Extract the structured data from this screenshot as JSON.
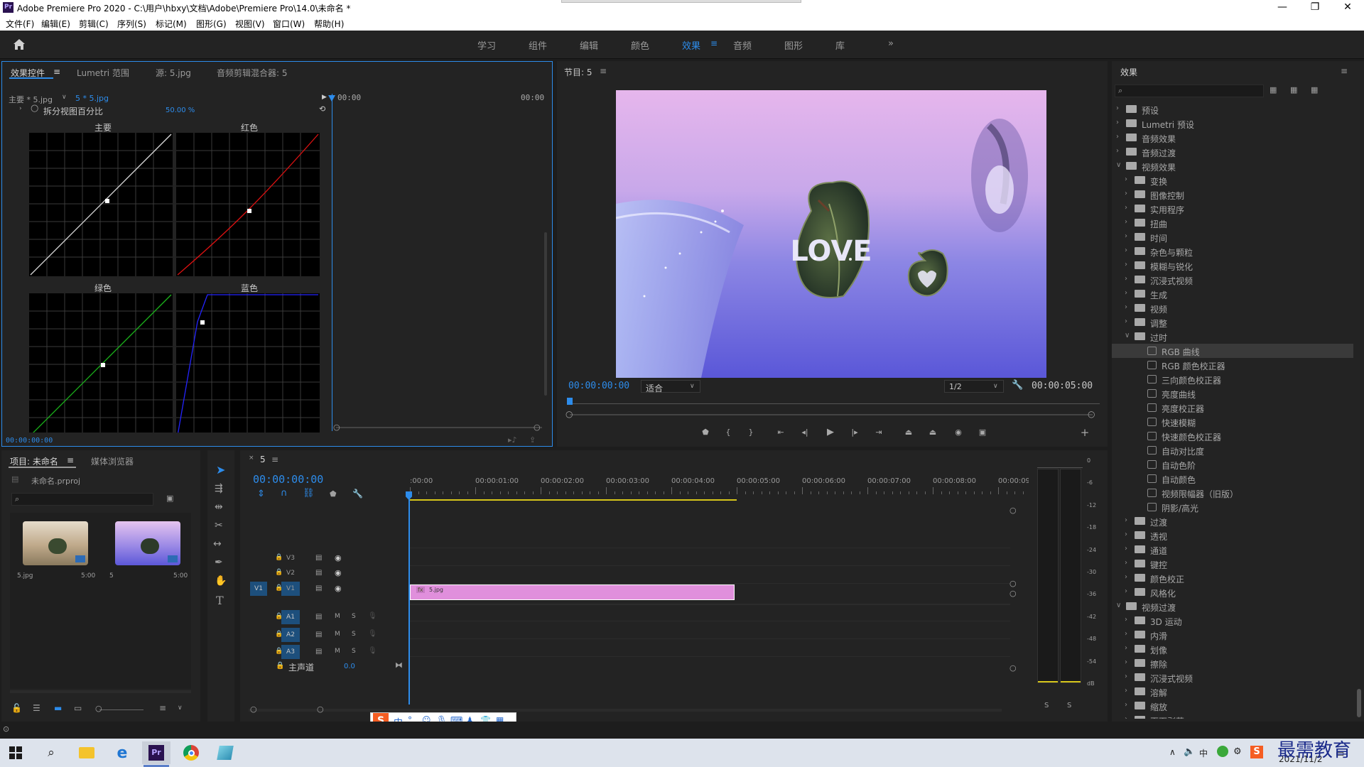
{
  "window": {
    "title": "Adobe Premiere Pro 2020 - C:\\用户\\hbxy\\文档\\Adobe\\Premiere Pro\\14.0\\未命名 *",
    "logo": "Pr"
  },
  "menu": [
    "文件(F)",
    "编辑(E)",
    "剪辑(C)",
    "序列(S)",
    "标记(M)",
    "图形(G)",
    "视图(V)",
    "窗口(W)",
    "帮助(H)"
  ],
  "workspaces": [
    "学习",
    "组件",
    "编辑",
    "颜色",
    "效果",
    "音频",
    "图形",
    "库"
  ],
  "active_workspace": "效果",
  "effect_controls": {
    "tabs": [
      "效果控件",
      "Lumetri 范围",
      "源: 5.jpg",
      "音频剪辑混合器: 5"
    ],
    "master_clip": "主要 * 5.jpg",
    "seq_clip": "5 * 5.jpg",
    "split_label": "拆分视图百分比",
    "split_value": "50.00 %",
    "time_start": "00:00",
    "time_end": "00:00",
    "curve_labels": [
      "主要",
      "红色",
      "绿色",
      "蓝色"
    ],
    "timecode": "00:00:00:00"
  },
  "program": {
    "tab": "节目: 5",
    "timecode": "00:00:00:00",
    "fit": "适合",
    "resolution": "1/2",
    "duration": "00:00:05:00",
    "image_text": "LOVE"
  },
  "effects_panel": {
    "title": "效果",
    "tree": [
      {
        "label": "预设",
        "level": 0,
        "type": "folder",
        "open": false
      },
      {
        "label": "Lumetri 预设",
        "level": 0,
        "type": "folder",
        "open": false
      },
      {
        "label": "音频效果",
        "level": 0,
        "type": "folder",
        "open": false
      },
      {
        "label": "音频过渡",
        "level": 0,
        "type": "folder",
        "open": false
      },
      {
        "label": "视频效果",
        "level": 0,
        "type": "folder",
        "open": true
      },
      {
        "label": "变换",
        "level": 1,
        "type": "folder",
        "open": false
      },
      {
        "label": "图像控制",
        "level": 1,
        "type": "folder",
        "open": false
      },
      {
        "label": "实用程序",
        "level": 1,
        "type": "folder",
        "open": false
      },
      {
        "label": "扭曲",
        "level": 1,
        "type": "folder",
        "open": false
      },
      {
        "label": "时间",
        "level": 1,
        "type": "folder",
        "open": false
      },
      {
        "label": "杂色与颗粒",
        "level": 1,
        "type": "folder",
        "open": false
      },
      {
        "label": "模糊与锐化",
        "level": 1,
        "type": "folder",
        "open": false
      },
      {
        "label": "沉浸式视频",
        "level": 1,
        "type": "folder",
        "open": false
      },
      {
        "label": "生成",
        "level": 1,
        "type": "folder",
        "open": false
      },
      {
        "label": "视频",
        "level": 1,
        "type": "folder",
        "open": false
      },
      {
        "label": "调整",
        "level": 1,
        "type": "folder",
        "open": false
      },
      {
        "label": "过时",
        "level": 1,
        "type": "folder",
        "open": true
      },
      {
        "label": "RGB 曲线",
        "level": 2,
        "type": "fx",
        "sel": true
      },
      {
        "label": "RGB 颜色校正器",
        "level": 2,
        "type": "fx"
      },
      {
        "label": "三向颜色校正器",
        "level": 2,
        "type": "fx"
      },
      {
        "label": "亮度曲线",
        "level": 2,
        "type": "fx"
      },
      {
        "label": "亮度校正器",
        "level": 2,
        "type": "fx"
      },
      {
        "label": "快速模糊",
        "level": 2,
        "type": "fx"
      },
      {
        "label": "快速颜色校正器",
        "level": 2,
        "type": "fx"
      },
      {
        "label": "自动对比度",
        "level": 2,
        "type": "fx"
      },
      {
        "label": "自动色阶",
        "level": 2,
        "type": "fx"
      },
      {
        "label": "自动颜色",
        "level": 2,
        "type": "fx"
      },
      {
        "label": "视频限幅器（旧版）",
        "level": 2,
        "type": "fx"
      },
      {
        "label": "阴影/高光",
        "level": 2,
        "type": "fx"
      },
      {
        "label": "过渡",
        "level": 1,
        "type": "folder",
        "open": false
      },
      {
        "label": "透视",
        "level": 1,
        "type": "folder",
        "open": false
      },
      {
        "label": "通道",
        "level": 1,
        "type": "folder",
        "open": false
      },
      {
        "label": "键控",
        "level": 1,
        "type": "folder",
        "open": false
      },
      {
        "label": "颜色校正",
        "level": 1,
        "type": "folder",
        "open": false
      },
      {
        "label": "风格化",
        "level": 1,
        "type": "folder",
        "open": false
      },
      {
        "label": "视频过渡",
        "level": 0,
        "type": "folder",
        "open": true
      },
      {
        "label": "3D 运动",
        "level": 1,
        "type": "folder",
        "open": false
      },
      {
        "label": "内滑",
        "level": 1,
        "type": "folder",
        "open": false
      },
      {
        "label": "划像",
        "level": 1,
        "type": "folder",
        "open": false
      },
      {
        "label": "擦除",
        "level": 1,
        "type": "folder",
        "open": false
      },
      {
        "label": "沉浸式视频",
        "level": 1,
        "type": "folder",
        "open": false
      },
      {
        "label": "溶解",
        "level": 1,
        "type": "folder",
        "open": false
      },
      {
        "label": "缩放",
        "level": 1,
        "type": "folder",
        "open": false
      },
      {
        "label": "页面剥落",
        "level": 1,
        "type": "folder",
        "open": false
      }
    ]
  },
  "project": {
    "tabs": [
      "项目: 未命名",
      "媒体浏览器"
    ],
    "file": "未命名.prproj",
    "items": [
      {
        "name": "5.jpg",
        "dur": "5:00"
      },
      {
        "name": "5",
        "dur": "5:00"
      }
    ]
  },
  "timeline": {
    "tab": "5",
    "timecode": "00:00:00:00",
    "ruler": [
      ":00:00",
      "00:00:01:00",
      "00:00:02:00",
      "00:00:03:00",
      "00:00:04:00",
      "00:00:05:00",
      "00:00:06:00",
      "00:00:07:00",
      "00:00:08:00",
      "00:00:09:"
    ],
    "video_tracks": [
      "V3",
      "V2",
      "V1"
    ],
    "audio_tracks": [
      "A1",
      "A2",
      "A3"
    ],
    "source_patch": "V1",
    "master": "主声道",
    "master_val": "0.0",
    "clip_name": "5.jpg",
    "clip_fx": "fx",
    "mute": "M",
    "solo": "S"
  },
  "audio_meter": {
    "labels": [
      "0",
      "-6",
      "-12",
      "-18",
      "-24",
      "-30",
      "-36",
      "-42",
      "-48",
      "-54",
      "dB"
    ],
    "solo": [
      "S",
      "S"
    ]
  },
  "ime": {
    "label": "中"
  },
  "taskbar": {
    "clock": "2021/11/2",
    "ime": "中",
    "watermark": "最需教育"
  }
}
